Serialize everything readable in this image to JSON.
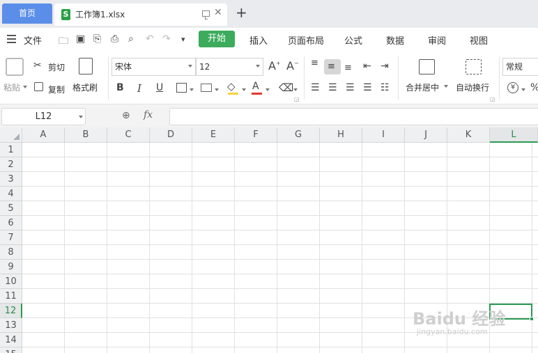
{
  "tabs": {
    "home_label": "首页",
    "file_icon_letter": "S",
    "file_name": "工作簿1.xlsx"
  },
  "menu": {
    "file_label": "文件",
    "tabs": [
      "开始",
      "插入",
      "页面布局",
      "公式",
      "数据",
      "审阅",
      "视图"
    ],
    "active_tab": "开始"
  },
  "ribbon": {
    "paste_label": "粘贴",
    "cut_label": "剪切",
    "copy_label": "复制",
    "format_painter_label": "格式刷",
    "font_name": "宋体",
    "font_size": "12",
    "merge_label": "合并居中",
    "wrap_label": "自动换行",
    "number_format": "常规"
  },
  "formula_bar": {
    "cell_ref": "L12",
    "fx_label": "fx",
    "formula": ""
  },
  "grid": {
    "columns": [
      "A",
      "B",
      "C",
      "D",
      "E",
      "F",
      "G",
      "H",
      "I",
      "J",
      "K",
      "L"
    ],
    "rows": [
      "1",
      "2",
      "3",
      "4",
      "5",
      "6",
      "7",
      "8",
      "9",
      "10",
      "11",
      "12",
      "13",
      "14",
      "15"
    ],
    "selected_col": "L",
    "selected_row": "12"
  },
  "watermark": {
    "main": "Baidu 经验",
    "sub": "jingyan.baidu.com"
  },
  "colors": {
    "accent_green": "#3cab5c",
    "home_blue": "#5b8ee8",
    "selection_green": "#2a9a52"
  }
}
